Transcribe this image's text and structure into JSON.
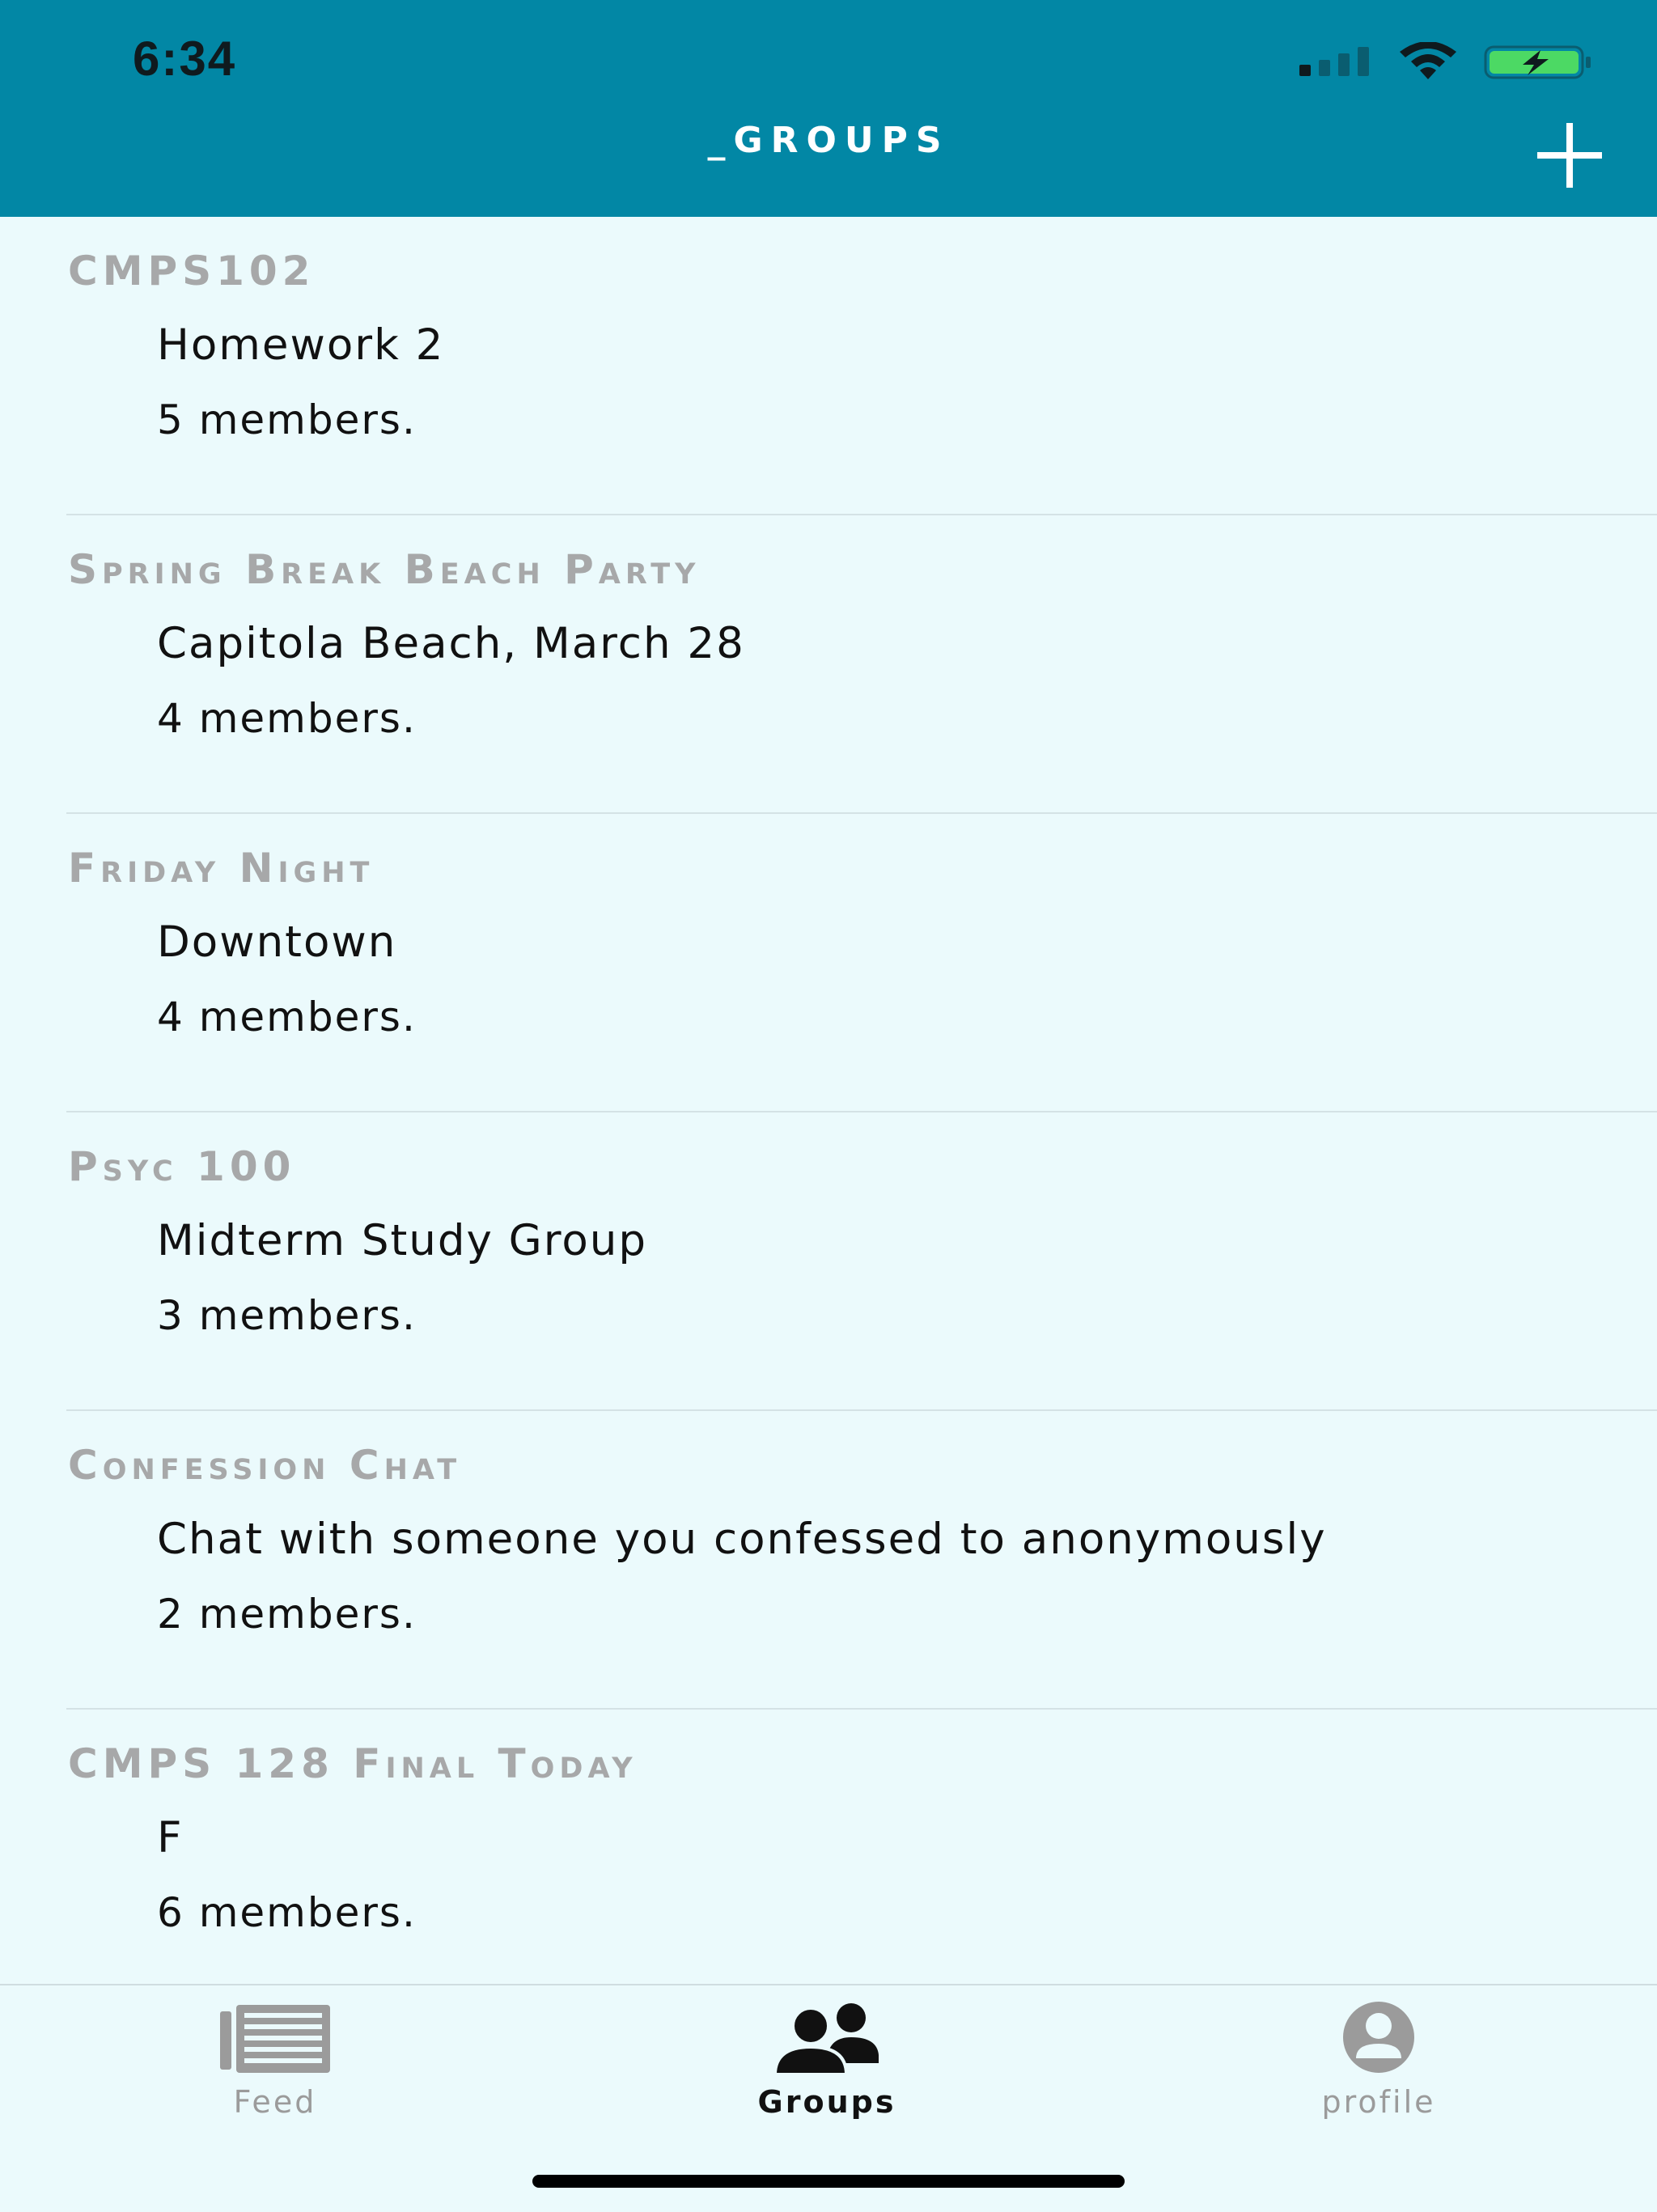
{
  "status_bar": {
    "time": "6:34"
  },
  "header": {
    "title": "_GROUPS",
    "add_icon": "plus-icon"
  },
  "groups": [
    {
      "name": "CMPS102",
      "description": "Homework 2",
      "members": "5 members."
    },
    {
      "name": "Spring Break Beach Party",
      "description": "Capitola Beach, March 28",
      "members": "4 members."
    },
    {
      "name": "Friday Night",
      "description": "Downtown",
      "members": "4 members."
    },
    {
      "name": "Psyc 100",
      "description": "Midterm Study Group",
      "members": "3 members."
    },
    {
      "name": "Confession Chat",
      "description": "Chat with someone you confessed to anonymously",
      "members": "2 members."
    },
    {
      "name": "CMPS 128 Final Today",
      "description": "F",
      "members": "6 members."
    }
  ],
  "tabbar": {
    "feed": {
      "label": "Feed",
      "icon": "newspaper-icon"
    },
    "groups": {
      "label": "Groups",
      "icon": "people-icon",
      "active": true
    },
    "profile": {
      "label": "profile",
      "icon": "user-circle-icon"
    }
  },
  "colors": {
    "header_bg": "#0287a5",
    "page_bg": "#ebfafc",
    "group_name": "#a7a8a9",
    "tab_inactive": "#9b9b9b",
    "battery_fill": "#4cd964"
  }
}
